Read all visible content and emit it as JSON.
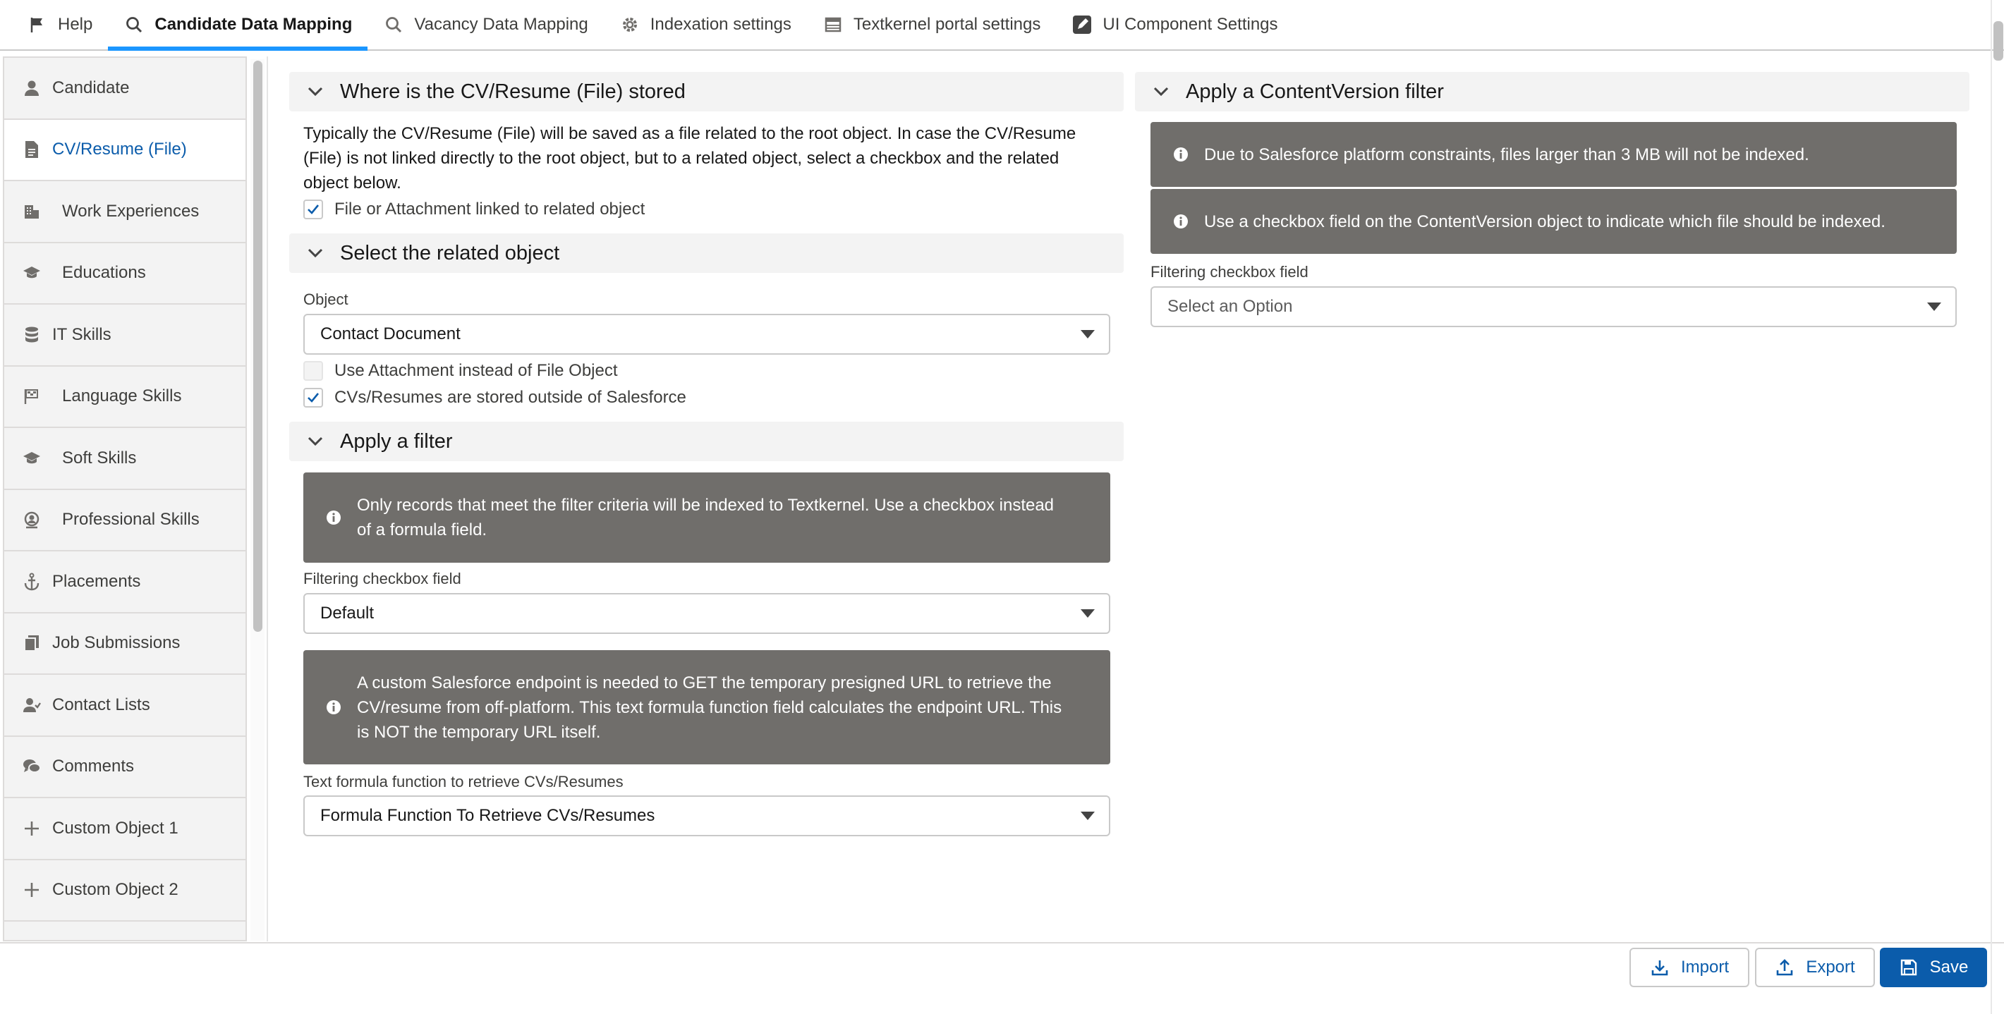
{
  "tabs": [
    {
      "label": "Help",
      "icon": "flag-icon"
    },
    {
      "label": "Candidate Data Mapping",
      "icon": "search-icon",
      "active": true
    },
    {
      "label": "Vacancy Data Mapping",
      "icon": "search-icon"
    },
    {
      "label": "Indexation settings",
      "icon": "gear-icon"
    },
    {
      "label": "Textkernel portal settings",
      "icon": "table-icon"
    },
    {
      "label": "UI Component Settings",
      "icon": "edit-icon"
    }
  ],
  "sidebar": {
    "items": [
      {
        "label": "Candidate",
        "icon": "person-icon"
      },
      {
        "label": "CV/Resume (File)",
        "icon": "document-icon",
        "active": true
      },
      {
        "label": "Work Experiences",
        "icon": "building-icon"
      },
      {
        "label": "Educations",
        "icon": "graduation-cap-icon"
      },
      {
        "label": "IT Skills",
        "icon": "database-icon"
      },
      {
        "label": "Language Skills",
        "icon": "language-flag-icon"
      },
      {
        "label": "Soft Skills",
        "icon": "graduation-cap-icon"
      },
      {
        "label": "Professional Skills",
        "icon": "badge-icon"
      },
      {
        "label": "Placements",
        "icon": "anchor-icon"
      },
      {
        "label": "Job Submissions",
        "icon": "files-icon"
      },
      {
        "label": "Contact Lists",
        "icon": "contacts-icon"
      },
      {
        "label": "Comments",
        "icon": "comments-icon"
      },
      {
        "label": "Custom Object 1",
        "icon": "plus-icon"
      },
      {
        "label": "Custom Object 2",
        "icon": "plus-icon"
      }
    ]
  },
  "storage": {
    "title": "Where is the CV/Resume (File) stored",
    "description_line1": "Typically the CV/Resume (File) will be saved as a file related to the root object. In case the CV/Resume",
    "description_line2": "(File) is not linked directly to the root object, but to a related object, select a checkbox and the related",
    "description_line3": "object below.",
    "linked_checkbox_label": "File or Attachment linked to related object",
    "linked_checked": true
  },
  "related_object": {
    "title": "Select the related object",
    "object_label": "Object",
    "object_value": "Contact Document",
    "attachment_checkbox_label": "Use Attachment instead of File Object",
    "attachment_checked": false,
    "outside_checkbox_label": "CVs/Resumes are stored outside of Salesforce",
    "outside_checked": true
  },
  "filter": {
    "title": "Apply a filter",
    "info_line1": "Only records that meet the filter criteria will be indexed to Textkernel. Use a checkbox instead",
    "info_line2": "of a formula field.",
    "filter_field_label": "Filtering checkbox field",
    "filter_field_value": "Default",
    "endpoint_info_line1": "A custom Salesforce endpoint is needed to GET the temporary presigned URL to retrieve the",
    "endpoint_info_line2": "CV/resume from off-platform. This text formula function field calculates the endpoint URL. This",
    "endpoint_info_line3": "is NOT the temporary URL itself.",
    "formula_label": "Text formula function to retrieve CVs/Resumes",
    "formula_value": "Formula Function To Retrieve CVs/Resumes"
  },
  "content_version": {
    "title": "Apply a ContentVersion filter",
    "info1": "Due to Salesforce platform constraints, files larger than 3 MB will not be indexed.",
    "info2": "Use a checkbox field on the ContentVersion object to indicate which file should be indexed.",
    "filter_field_label": "Filtering checkbox field",
    "filter_field_placeholder": "Select an Option"
  },
  "footer": {
    "import_label": "Import",
    "export_label": "Export",
    "save_label": "Save"
  },
  "colors": {
    "accent": "#1b96ff",
    "brand": "#0b5cab",
    "info_bg": "#706e6b"
  }
}
